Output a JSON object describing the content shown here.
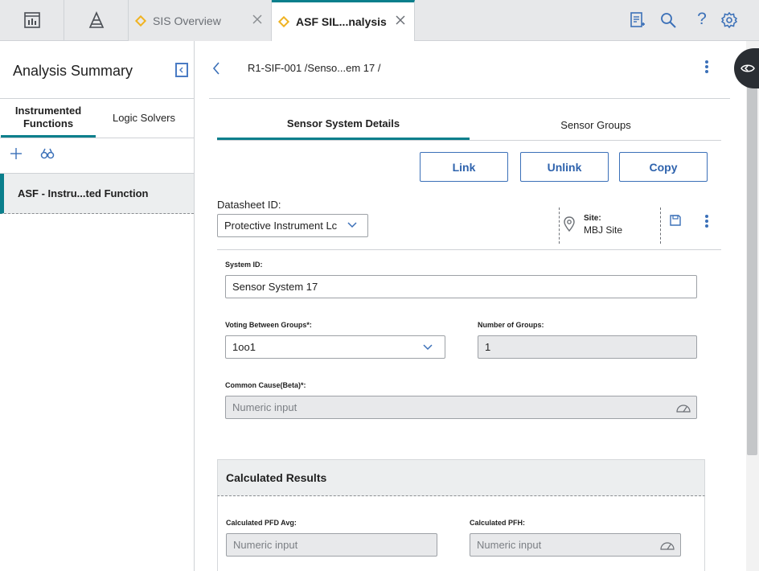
{
  "topbar": {
    "tabs": [
      {
        "label": "SIS Overview",
        "active": false
      },
      {
        "label": "ASF SIL...nalysis",
        "active": true
      }
    ],
    "icons": [
      "dashboard-icon",
      "hierarchy-icon",
      "report-icon",
      "search-icon",
      "help-icon",
      "settings-icon"
    ],
    "help_glyph": "?"
  },
  "left_panel": {
    "title": "Analysis Summary",
    "tabs": [
      {
        "label": "Instrumented Functions",
        "active": true
      },
      {
        "label": "Logic Solvers",
        "active": false
      }
    ],
    "items": [
      {
        "label": "ASF - Instru...ted Function",
        "selected": true
      }
    ]
  },
  "main": {
    "breadcrumb": "R1-SIF-001 /Senso...em 17 /",
    "section_tabs": [
      {
        "label": "Sensor System Details",
        "active": true
      },
      {
        "label": "Sensor Groups",
        "active": false
      }
    ],
    "buttons": {
      "link": "Link",
      "unlink": "Unlink",
      "copy": "Copy"
    },
    "datasheet": {
      "label": "Datasheet ID:",
      "value": "Protective Instrument Lc"
    },
    "site": {
      "label": "Site:",
      "value": "MBJ Site"
    },
    "fields": {
      "system_id": {
        "label": "System ID:",
        "value": "Sensor System 17"
      },
      "voting": {
        "label": "Voting Between Groups*:",
        "value": "1oo1"
      },
      "num_groups": {
        "label": "Number of Groups:",
        "value": "1"
      },
      "common_cause": {
        "label": "Common Cause(Beta)*:",
        "placeholder": "Numeric input"
      }
    },
    "calculated": {
      "title": "Calculated Results",
      "pfd_avg": {
        "label": "Calculated PFD Avg:",
        "placeholder": "Numeric input"
      },
      "pfh": {
        "label": "Calculated PFH:",
        "placeholder": "Numeric input"
      }
    }
  },
  "colors": {
    "accent": "#0a7f8c",
    "button_blue": "#2f63ad",
    "tab_diamond": "#f0b323"
  }
}
